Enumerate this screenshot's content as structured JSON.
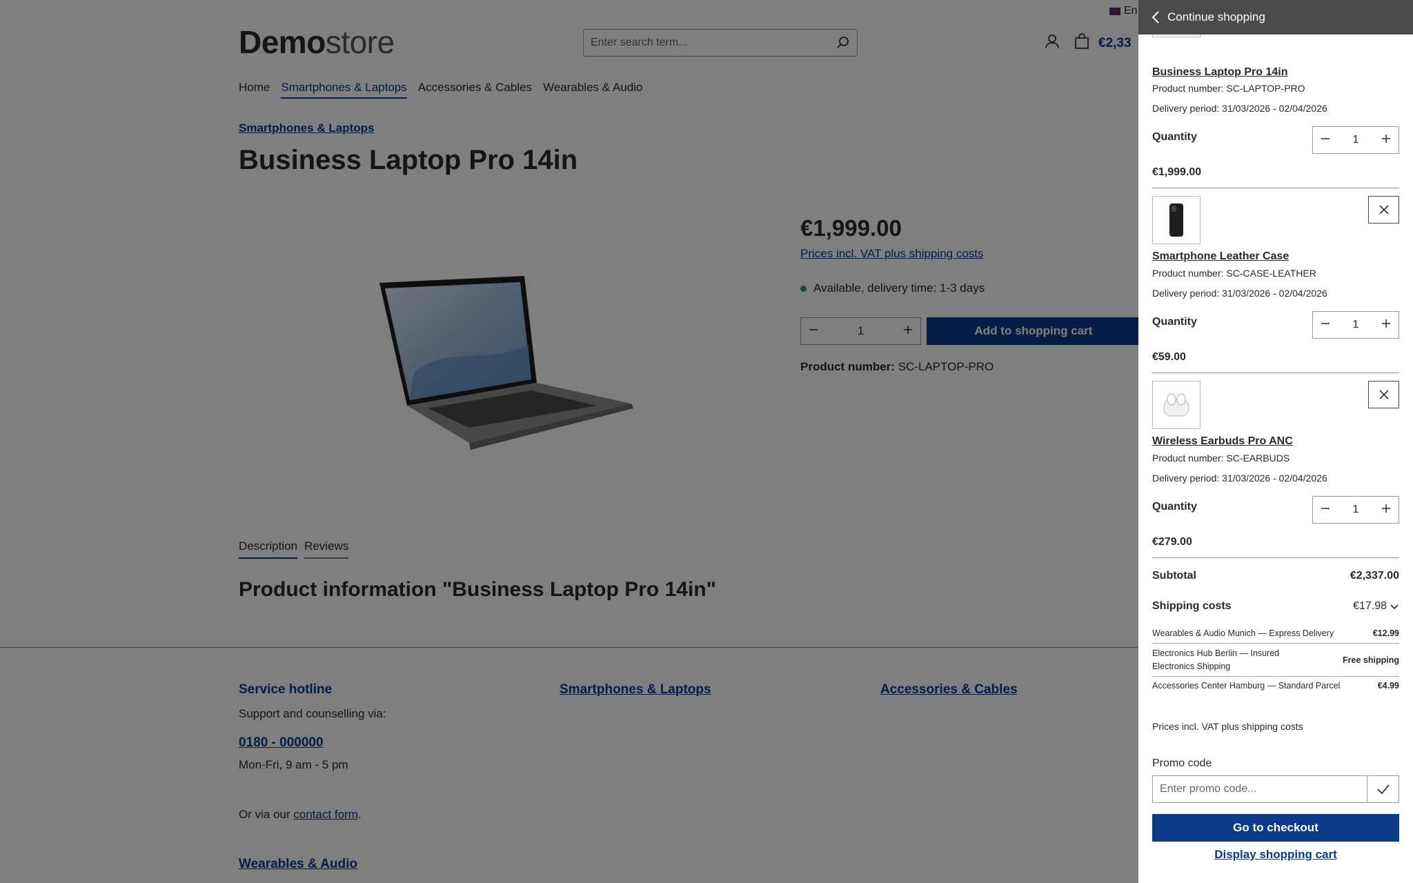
{
  "header": {
    "language": "En",
    "logo_bold": "Demo",
    "logo_light": "store",
    "search_placeholder": "Enter search term...",
    "cart_total": "€2,33"
  },
  "nav": {
    "items": [
      "Home",
      "Smartphones & Laptops",
      "Accessories & Cables",
      "Wearables & Audio"
    ],
    "active": "Smartphones & Laptops"
  },
  "product": {
    "breadcrumb": "Smartphones & Laptops",
    "title": "Business Laptop Pro 14in",
    "price": "€1,999.00",
    "vat_link": "Prices incl. VAT plus shipping costs",
    "availability": "Available, delivery time: 1-3 days",
    "quantity": "1",
    "add_to_cart": "Add to shopping cart",
    "number_label": "Product number:",
    "number_value": "SC-LAPTOP-PRO"
  },
  "tabs": [
    "Description",
    "Reviews"
  ],
  "product_info_heading": "Product information \"Business Laptop Pro 14in\"",
  "footer": {
    "hotline_title": "Service hotline",
    "support_text": "Support and counselling via:",
    "phone": "0180 - 000000",
    "hours": "Mon-Fri, 9 am - 5 pm",
    "contact_prefix": "Or via our ",
    "contact_link": "contact form",
    "contact_suffix": ".",
    "col2_title": "Smartphones & Laptops",
    "col3_title": "Accessories & Cables",
    "col4_title": "Wearables & Audio"
  },
  "cart": {
    "header": "Continue shopping",
    "items": [
      {
        "name": "Business Laptop Pro 14in",
        "number": "Product number: SC-LAPTOP-PRO",
        "delivery": "Delivery period: 31/03/2026 - 02/04/2026",
        "quantity_label": "Quantity",
        "quantity": "1",
        "price": "€1,999.00",
        "thumb_icon": "laptop-icon"
      },
      {
        "name": "Smartphone Leather Case",
        "number": "Product number: SC-CASE-LEATHER",
        "delivery": "Delivery period: 31/03/2026 - 02/04/2026",
        "quantity_label": "Quantity",
        "quantity": "1",
        "price": "€59.00",
        "thumb_icon": "phone-case-icon"
      },
      {
        "name": "Wireless Earbuds Pro ANC",
        "number": "Product number: SC-EARBUDS",
        "delivery": "Delivery period: 31/03/2026 - 02/04/2026",
        "quantity_label": "Quantity",
        "quantity": "1",
        "price": "€279.00",
        "thumb_icon": "earbuds-icon"
      }
    ],
    "subtotal_label": "Subtotal",
    "subtotal": "€2,337.00",
    "shipping_label": "Shipping costs",
    "shipping_total": "€17.98",
    "shipping_lines": [
      {
        "label": "Wearables & Audio Munich — Express Delivery",
        "value": "€12.99"
      },
      {
        "label": "Electronics Hub Berlin — Insured Electronics Shipping",
        "value": "Free shipping"
      },
      {
        "label": "Accessories Center Hamburg — Standard Parcel",
        "value": "€4.99"
      }
    ],
    "vat_note": "Prices incl. VAT plus shipping costs",
    "promo_label": "Promo code",
    "promo_placeholder": "Enter promo code...",
    "checkout": "Go to checkout",
    "display_cart": "Display shopping cart"
  },
  "colors": {
    "brand": "#0b3a8a",
    "available": "#2c9b56",
    "overlay": "rgba(0,0,0,0.5)",
    "offcanvas_header": "#4a4a4a"
  }
}
